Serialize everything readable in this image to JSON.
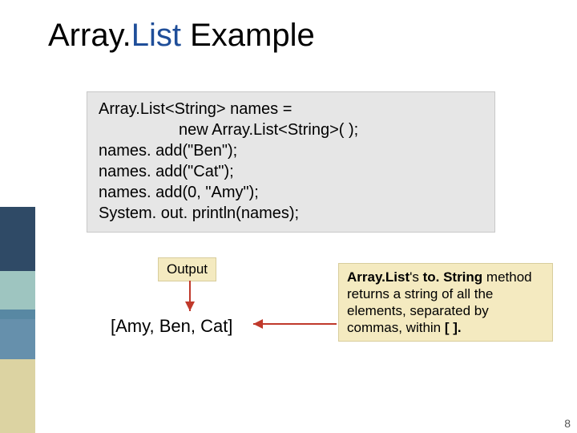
{
  "title": {
    "black1": "Array.",
    "blue": "List",
    "black2": " Example"
  },
  "code": "Array.List<String> names =\n                  new Array.List<String>( );\nnames. add(\"Ben\");\nnames. add(\"Cat\");\nnames. add(0, \"Amy\");\nSystem. out. println(names);",
  "output_label": "Output",
  "output_value": "[Amy, Ben, Cat]",
  "note": {
    "bold1": "Array.List",
    "plain1": "'s ",
    "bold2": "to. String",
    "plain2": " method returns a string of all the elements, separated by commas, within ",
    "bold3": "[  ].",
    "plain3": ""
  },
  "page": "8",
  "chart_data": null
}
